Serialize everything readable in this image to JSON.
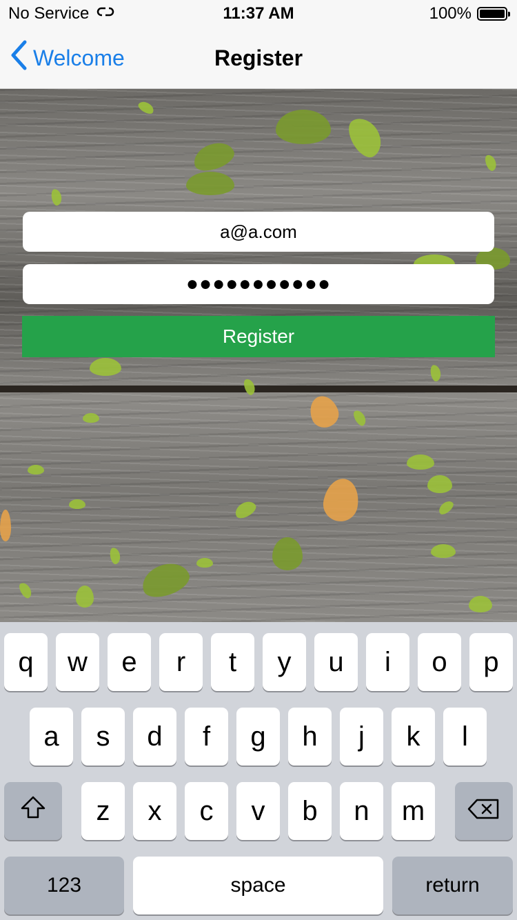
{
  "status_bar": {
    "carrier": "No Service",
    "time": "11:37 AM",
    "battery": "100%"
  },
  "nav": {
    "back_label": "Welcome",
    "title": "Register"
  },
  "form": {
    "email_value": "a@a.com",
    "password_value": "●●●●●●●●●●●",
    "register_label": "Register",
    "button_color": "#25a24a"
  },
  "keyboard": {
    "row1": [
      "q",
      "w",
      "e",
      "r",
      "t",
      "y",
      "u",
      "i",
      "o",
      "p"
    ],
    "row2": [
      "a",
      "s",
      "d",
      "f",
      "g",
      "h",
      "j",
      "k",
      "l"
    ],
    "row3": [
      "z",
      "x",
      "c",
      "v",
      "b",
      "n",
      "m"
    ],
    "numbers_label": "123",
    "space_label": "space",
    "return_label": "return"
  },
  "icons": [
    "wifi-link-icon",
    "battery-icon",
    "back-chevron-icon",
    "shift-icon",
    "delete-icon"
  ]
}
